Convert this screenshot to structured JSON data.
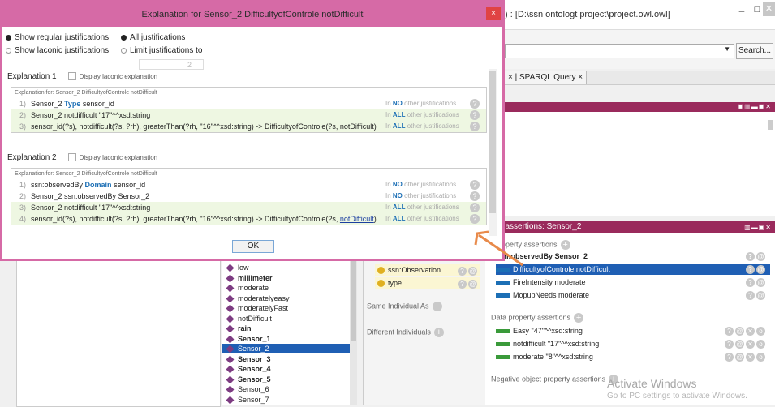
{
  "window": {
    "title_suffix": ") : [D:\\ssn ontologt project\\project.owl.owl]",
    "minimize": "–",
    "maximize": "□",
    "close": "✕"
  },
  "toolbar": {
    "search_label": "Search..."
  },
  "tabs": {
    "sparql": "SPARQL Query ×",
    "prev_close": "×"
  },
  "property_panel": {
    "header": "erty assertions: Sensor_2",
    "object_section": "t property assertions",
    "object_rows": [
      {
        "label": "ssn:observedBy  Sensor_2",
        "bold": true
      },
      {
        "label": "DifficultyofControle  notDifficult",
        "selected": true
      },
      {
        "label": "FireIntensity  moderate"
      },
      {
        "label": "MopupNeeds  moderate"
      }
    ],
    "data_section": "Data property assertions",
    "data_rows": [
      {
        "label": "Easy  \"47\"^^xsd:string"
      },
      {
        "label": "notdifficult  \"17\"^^xsd:string"
      },
      {
        "label": "moderate  \"8\"^^xsd:string"
      }
    ],
    "negative_section": "Negative object property assertions"
  },
  "activate": {
    "line1": "Activate Windows",
    "line2": "Go to PC settings to activate Windows."
  },
  "types_panel": {
    "types": [
      "ssn:Observation",
      "type"
    ],
    "same_individual": "Same Individual As",
    "different_individuals": "Different Individuals"
  },
  "individuals": [
    {
      "name": "low",
      "bold": false
    },
    {
      "name": "millimeter",
      "bold": true
    },
    {
      "name": "moderate",
      "bold": false
    },
    {
      "name": "moderatelyeasy",
      "bold": false
    },
    {
      "name": "moderatelyFast",
      "bold": false
    },
    {
      "name": "notDifficult",
      "bold": false
    },
    {
      "name": "rain",
      "bold": true
    },
    {
      "name": "Sensor_1",
      "bold": true
    },
    {
      "name": "Sensor_2",
      "bold": false,
      "selected": true
    },
    {
      "name": "Sensor_3",
      "bold": true
    },
    {
      "name": "Sensor_4",
      "bold": true
    },
    {
      "name": "Sensor_5",
      "bold": true
    },
    {
      "name": "Sensor_6",
      "bold": false
    },
    {
      "name": "Sensor_7",
      "bold": false
    }
  ],
  "dialog": {
    "title": "Explanation for Sensor_2 DifficultyofControle notDifficult",
    "close": "×",
    "radio_regular": "Show regular justifications",
    "radio_laconic": "Show laconic justifications",
    "radio_all": "All justifications",
    "radio_limit": "Limit justifications to",
    "limit_value": "2",
    "ok": "OK",
    "explanations": [
      {
        "title": "Explanation 1",
        "laconic_label": "Display laconic explanation",
        "for": "Explanation for: Sensor_2 DifficultyofControle notDifficult",
        "axioms": [
          {
            "n": "1)",
            "pre": "Sensor_2 ",
            "kw": "Type",
            "post": " sensor_id",
            "scope": "NO",
            "green": false
          },
          {
            "n": "2)",
            "pre": "Sensor_2 notdifficult \"17\"^^xsd:string",
            "kw": "",
            "post": "",
            "scope": "ALL",
            "green": true
          },
          {
            "n": "3)",
            "pre": "sensor_id(?s), notdifficult(?s, ?rh), greaterThan(?rh, \"16\"^^xsd:string) -> DifficultyofControle(?s, notDifficult)",
            "kw": "",
            "post": "",
            "scope": "ALL",
            "green": true
          }
        ]
      },
      {
        "title": "Explanation 2",
        "laconic_label": "Display laconic explanation",
        "for": "Explanation for: Sensor_2 DifficultyofControle notDifficult",
        "axioms": [
          {
            "n": "1)",
            "pre": "ssn:observedBy ",
            "kw": "Domain",
            "post": " sensor_id",
            "scope": "NO",
            "green": false
          },
          {
            "n": "2)",
            "pre": "Sensor_2 ssn:observedBy Sensor_2",
            "kw": "",
            "post": "",
            "scope": "NO",
            "green": false
          },
          {
            "n": "3)",
            "pre": "Sensor_2 notdifficult \"17\"^^xsd:string",
            "kw": "",
            "post": "",
            "scope": "ALL",
            "green": true
          },
          {
            "n": "4)",
            "pre": "sensor_id(?s), notdifficult(?s, ?rh), greaterThan(?rh, \"16\"^^xsd:string) -> DifficultyofControle(?s, ",
            "kw": "",
            "post": ")",
            "link": "notDifficult",
            "scope": "ALL",
            "green": true
          }
        ]
      }
    ],
    "just_prefix": "In",
    "just_suffix": "other justifications",
    "qmark": "?"
  },
  "colors": {
    "dialog_border": "#d66aa6",
    "panel_header": "#9a2a5c",
    "selection": "#1f5fb4",
    "arrow": "#e88a4a"
  }
}
